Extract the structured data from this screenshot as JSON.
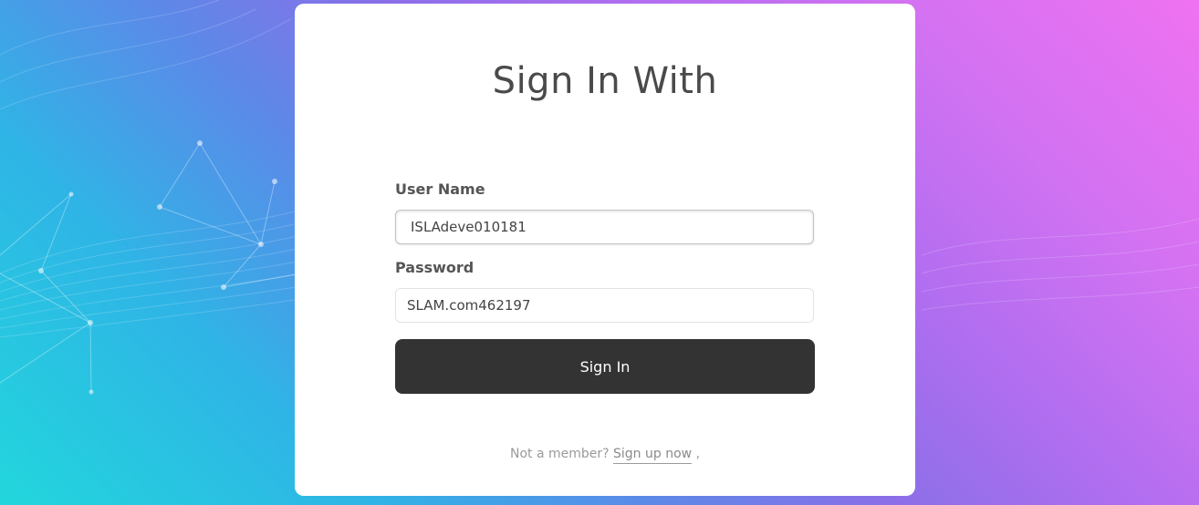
{
  "form": {
    "title": "Sign In With",
    "username_label": "User Name",
    "username_value": "ISLAdeve010181",
    "password_label": "Password",
    "password_value": "SLAM.com462197",
    "submit_label": "Sign In"
  },
  "footer": {
    "prompt": "Not a member?",
    "signup_link": "Sign up now",
    "trailing": ","
  },
  "colors": {
    "button": "#333333",
    "gradient_left": "#22d6dc",
    "gradient_right": "#ef72f1"
  }
}
